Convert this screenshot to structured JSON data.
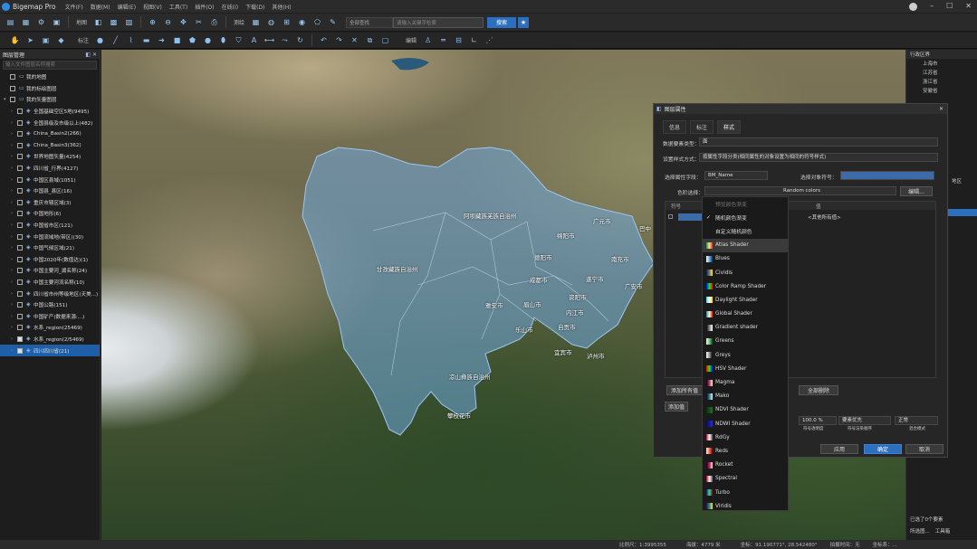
{
  "app": {
    "title": "Bigemap Pro",
    "menus": [
      "文件(F)",
      "数据(M)",
      "编辑(E)",
      "视图(V)",
      "工具(T)",
      "插件(O)",
      "在线(I)",
      "下载(D)",
      "其他(H)"
    ]
  },
  "toolbar": {
    "clear_label": "地图",
    "measure_label": "测绘",
    "search_scope": "全部查找",
    "search_placeholder": "请输入关键字检索",
    "search_button": "搜索",
    "draw_label": "标注",
    "edit_label": "编辑"
  },
  "left_panel": {
    "title": "图层管理",
    "search_placeholder": "输入文件图层名称搜索",
    "layers": [
      {
        "label": "我的地图",
        "checked": false,
        "expand": ""
      },
      {
        "label": "我的标绘图层",
        "checked": false,
        "expand": ""
      },
      {
        "label": "我的矢量图层",
        "checked": false,
        "expand": "▾"
      },
      {
        "label": "全国基础空区5地(9495)",
        "checked": false,
        "expand": "›"
      },
      {
        "label": "全国县级及市级以上(482)",
        "checked": false,
        "expand": "›"
      },
      {
        "label": "China_Basin2(266)",
        "checked": false,
        "expand": "›"
      },
      {
        "label": "China_Basin3(362)",
        "checked": false,
        "expand": "›"
      },
      {
        "label": "世界地图矢量(4254)",
        "checked": false,
        "expand": "›"
      },
      {
        "label": "四川省_行界(4127)",
        "checked": false,
        "expand": "›"
      },
      {
        "label": "中国区县域(1051)",
        "checked": false,
        "expand": "›"
      },
      {
        "label": "中国县_县区(16)",
        "checked": false,
        "expand": "›"
      },
      {
        "label": "重庆市辖区域(3)",
        "checked": false,
        "expand": "›"
      },
      {
        "label": "中国地形(6)",
        "checked": false,
        "expand": "›"
      },
      {
        "label": "中国省市区(121)",
        "checked": false,
        "expand": "›"
      },
      {
        "label": "中国流域地(带区)(30)",
        "checked": false,
        "expand": "›"
      },
      {
        "label": "中国气候区域(21)",
        "checked": false,
        "expand": "›"
      },
      {
        "label": "中国2020年(数值达)(1)",
        "checked": false,
        "expand": "›"
      },
      {
        "label": "中国主要河_湖名称(24)",
        "checked": false,
        "expand": "›"
      },
      {
        "label": "中国主要河流名称(10)",
        "checked": false,
        "expand": "›"
      },
      {
        "label": "四川省市州等级地区(天美...)",
        "checked": false,
        "expand": "›"
      },
      {
        "label": "中国公路(151)",
        "checked": false,
        "expand": "›"
      },
      {
        "label": "中国矿产(数据来源:...)",
        "checked": false,
        "expand": "›"
      },
      {
        "label": "水系_region(25469)",
        "checked": false,
        "expand": "›"
      },
      {
        "label": "水系_region(2/5469)",
        "checked": true,
        "expand": "›"
      },
      {
        "label": "四川四川省(21)",
        "checked": true,
        "expand": "›",
        "selected": true
      }
    ]
  },
  "right_panel": {
    "title": "行政区界",
    "items": [
      "上海市",
      "江苏省",
      "浙江省",
      "安徽省"
    ],
    "tag": "地区",
    "footer": "已选了0个要素",
    "tabs": [
      "所选图...",
      "工具箱"
    ]
  },
  "map_labels": [
    {
      "text": "阿坝藏族羌族自治州"
    },
    {
      "text": "广元市"
    },
    {
      "text": "巴中"
    },
    {
      "text": "绵阳市"
    },
    {
      "text": "南充市"
    },
    {
      "text": "甘孜藏族自治州"
    },
    {
      "text": "德阳市"
    },
    {
      "text": "遂宁市"
    },
    {
      "text": "广安市"
    },
    {
      "text": "成都市"
    },
    {
      "text": "雅安市"
    },
    {
      "text": "眉山市"
    },
    {
      "text": "资阳市"
    },
    {
      "text": "内江市"
    },
    {
      "text": "自贡市"
    },
    {
      "text": "乐山市"
    },
    {
      "text": "宜宾市"
    },
    {
      "text": "泸州市"
    },
    {
      "text": "凉山彝族自治州"
    },
    {
      "text": "攀枝花市"
    }
  ],
  "dialog": {
    "title": "图层属性",
    "tabs": [
      "信息",
      "标注",
      "样式"
    ],
    "data_type_label": "数据要素类型：",
    "data_type_value": "面",
    "style_label": "设置样式方式：",
    "style_value": "按属性字段分类(相同属性的对象设置为相同的符号样式)",
    "field_label": "选择属性字段：",
    "field_value": "BM_Name",
    "symbol_label": "选择对象符号：",
    "ramp_label": "色阶选择：",
    "ramp_value": "Random colors",
    "edit_button": "编辑...",
    "col_symbol": "符号",
    "col_value": "值",
    "other_value": "<其他所有值>",
    "add_all_button": "添加所有值",
    "delete_all_button": "全部删除",
    "add_value_button": "添加值",
    "opacity_value": "100.0 %",
    "opacity_caption": "符号透明度",
    "blend_value": "要素优先",
    "blend_caption": "符号渲染顺序",
    "mode_value": "正常",
    "mode_caption": "混合模式",
    "apply_button": "应用",
    "ok_button": "确定",
    "cancel_button": "取消"
  },
  "ramp_dropdown": {
    "header": "预览颜色渐变",
    "options": [
      {
        "label": "随机颜色渐变",
        "checked": true
      },
      {
        "label": "自定义随机颜色"
      },
      {
        "label": "Atlas Shader",
        "colors": [
          "#1a9850",
          "#fee08b",
          "#d73027"
        ],
        "hover": true
      },
      {
        "label": "Blues",
        "colors": [
          "#f7fbff",
          "#6baed6",
          "#08306b"
        ]
      },
      {
        "label": "Cividis",
        "colors": [
          "#00224e",
          "#7c7b78",
          "#fee838"
        ]
      },
      {
        "label": "Color Ramp Shader",
        "colors": [
          "#0000ff",
          "#00ff00",
          "#ff0000"
        ]
      },
      {
        "label": "Daylight Shader",
        "colors": [
          "#4dd2ff",
          "#ffffff",
          "#ffcc00"
        ]
      },
      {
        "label": "Global Shader",
        "colors": [
          "#2b83ba",
          "#ffffbf",
          "#d7191c"
        ]
      },
      {
        "label": "Gradient shader",
        "colors": [
          "#000000",
          "#888888",
          "#ffffff"
        ]
      },
      {
        "label": "Greens",
        "colors": [
          "#f7fcf5",
          "#74c476",
          "#00441b"
        ]
      },
      {
        "label": "Greys",
        "colors": [
          "#ffffff",
          "#969696",
          "#000000"
        ]
      },
      {
        "label": "HSV Shader",
        "colors": [
          "#ff0000",
          "#00ff00",
          "#0000ff"
        ]
      },
      {
        "label": "Magma",
        "colors": [
          "#000004",
          "#b73779",
          "#fcfdbf"
        ]
      },
      {
        "label": "Mako",
        "colors": [
          "#0b0405",
          "#357ba2",
          "#def5e5"
        ]
      },
      {
        "label": "NDVI Shader",
        "colors": [
          "#0b2f0b",
          "#1b4d1b",
          "#2a6b2a"
        ]
      },
      {
        "label": "NDWI Shader",
        "colors": [
          "#0a0a5a",
          "#1a1a8a",
          "#2a2acc"
        ]
      },
      {
        "label": "RdGy",
        "colors": [
          "#b2182b",
          "#ffffff",
          "#4d4d4d"
        ]
      },
      {
        "label": "Reds",
        "colors": [
          "#fff5f0",
          "#fb6a4a",
          "#67000d"
        ]
      },
      {
        "label": "Rocket",
        "colors": [
          "#03051a",
          "#cb1b4f",
          "#faebdd"
        ]
      },
      {
        "label": "Spectral",
        "colors": [
          "#9e0142",
          "#ffffbf",
          "#5e4fa2"
        ]
      },
      {
        "label": "Turbo",
        "colors": [
          "#30123b",
          "#1ae4b6",
          "#7a0403"
        ]
      },
      {
        "label": "Viridis",
        "colors": [
          "#440154",
          "#21918c",
          "#fde725"
        ]
      }
    ]
  },
  "status": {
    "scale": "比例尺：1:3995355",
    "altitude": "海拔：4779 米",
    "coords": "坐标：91.190771°, 28.542480°",
    "capture": "拍摄时间：无",
    "level": "坐标系：..."
  },
  "colors": {
    "accent": "#2d6fbf",
    "sichuan_fill": "#6fa8dc",
    "selected": "#1f5fa8"
  }
}
